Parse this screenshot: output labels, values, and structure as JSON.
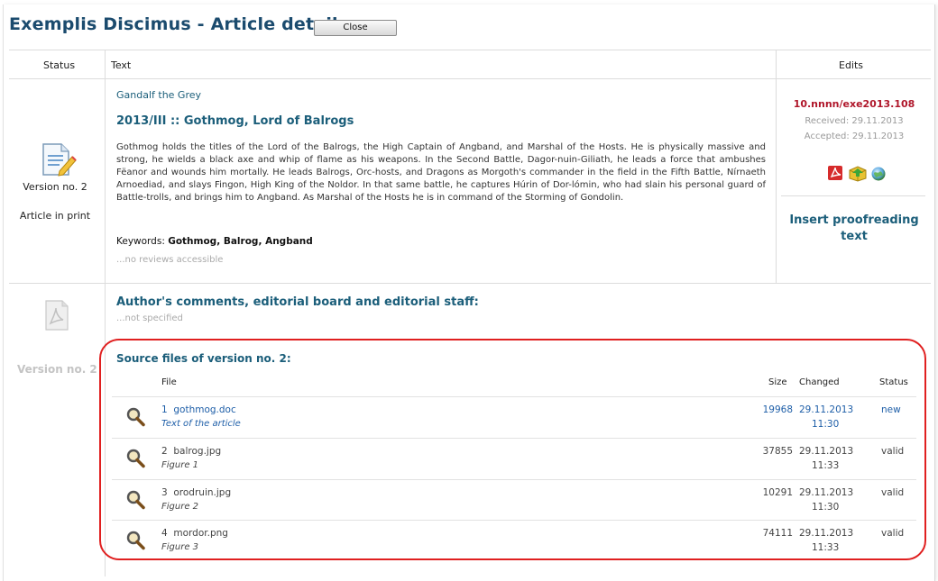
{
  "header": {
    "title": "Exemplis Discimus - Article detail",
    "close_label": "Close"
  },
  "columns": {
    "status": "Status",
    "text": "Text",
    "edits": "Edits"
  },
  "article": {
    "version_label": "Version no. 2",
    "state_label": "Article in print",
    "author": "Gandalf the Grey",
    "title": "2013/III :: Gothmog, Lord of Balrogs",
    "abstract": "Gothmog holds the titles of the Lord of the Balrogs, the High Captain of Angband, and Marshal of the Hosts. He is physically massive and strong, he wields a black axe and whip of flame as his weapons. In the Second Battle, Dagor-nuin-Giliath, he leads a force that ambushes Fëanor and wounds him mortally. He leads Balrogs, Orc-hosts, and Dragons as Morgoth's commander in the field in the Fifth Battle, Nírnaeth Arnoediad, and slays Fingon, High King of the Noldor. In that same battle, he captures Húrin of Dor-lómin, who had slain his personal guard of Battle-trolls, and brings him to Angband. As Marshal of the Hosts he is in command of the Storming of Gondolin.",
    "keywords_label": "Keywords:",
    "keywords": "Gothmog, Balrog, Angband",
    "reviews": "...no reviews accessible"
  },
  "edits": {
    "doi": "10.nnnn/exe2013.108",
    "received": "Received: 29.11.2013",
    "accepted": "Accepted: 29.11.2013",
    "icons": [
      "pdf-icon",
      "package-icon",
      "globe-icon"
    ],
    "proofreading_line1": "Insert proofreading",
    "proofreading_line2": "text"
  },
  "lower": {
    "version_label": "Version no. 2",
    "comments_title": "Author's comments, editorial board and editorial staff:",
    "comments_value": "...not specified",
    "source_title": "Source files of version no. 2:",
    "table_headers": {
      "file": "File",
      "size": "Size",
      "changed": "Changed",
      "status": "Status"
    },
    "files": [
      {
        "num": "1",
        "name": "gothmog.doc",
        "desc": "Text of the article",
        "size": "19968",
        "date": "29.11.2013",
        "time": "11:30",
        "status": "new"
      },
      {
        "num": "2",
        "name": "balrog.jpg",
        "desc": "Figure 1",
        "size": "37855",
        "date": "29.11.2013",
        "time": "11:33",
        "status": "valid"
      },
      {
        "num": "3",
        "name": "orodruin.jpg",
        "desc": "Figure 2",
        "size": "10291",
        "date": "29.11.2013",
        "time": "11:30",
        "status": "valid"
      },
      {
        "num": "4",
        "name": "mordor.png",
        "desc": "Figure 3",
        "size": "74111",
        "date": "29.11.2013",
        "time": "11:33",
        "status": "valid"
      }
    ]
  },
  "colors": {
    "title": "#1b4b6e",
    "teal": "#1b5e7a",
    "doi": "#b0172b",
    "link": "#1f5fa8",
    "highlight": "#e02020"
  }
}
